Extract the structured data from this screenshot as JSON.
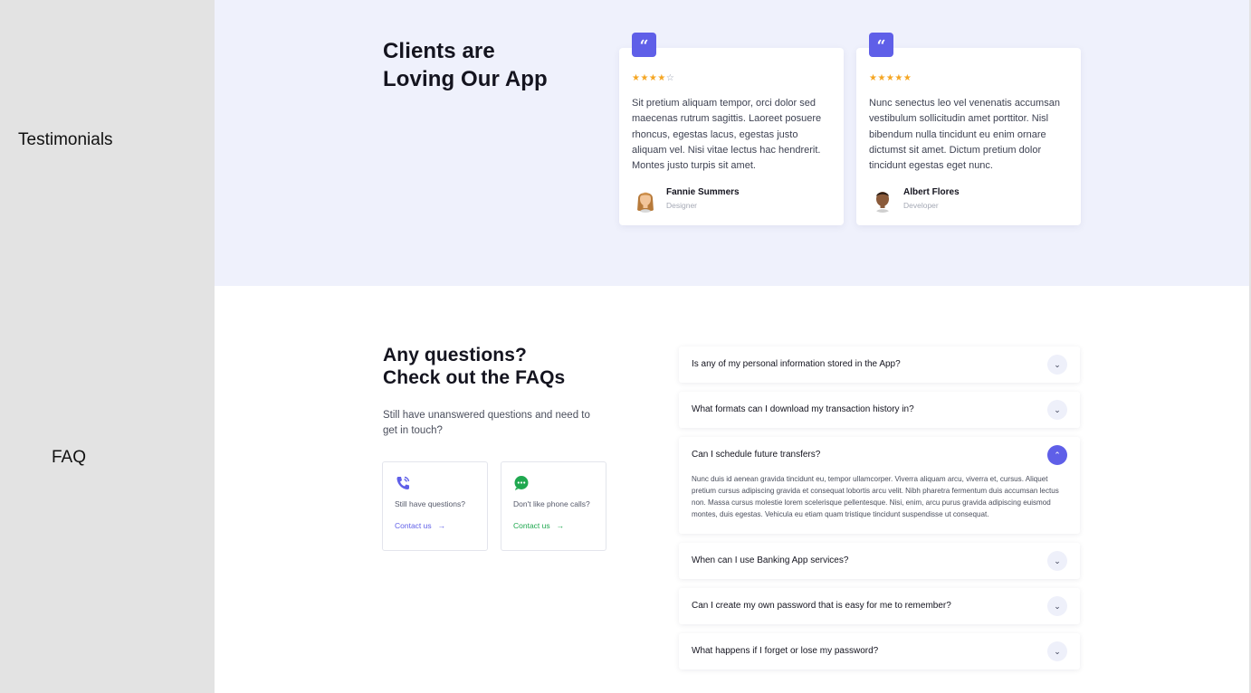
{
  "sidebar": {
    "testimonials_label": "Testimonials",
    "faq_label": "FAQ"
  },
  "testimonials": {
    "title_line1": "Clients are",
    "title_line2": "Loving Our App",
    "quote_glyph": "“",
    "cards": [
      {
        "stars_filled": "★★★★",
        "stars_empty": "☆",
        "rating": 4,
        "text": "Sit pretium aliquam tempor, orci dolor sed maecenas rutrum sagittis. Laoreet posuere rhoncus, egestas lacus, egestas justo aliquam vel. Nisi vitae lectus hac hendrerit. Montes justo turpis sit amet.",
        "name": "Fannie Summers",
        "role": "Designer",
        "avatar_icon": "female-avatar-icon"
      },
      {
        "stars_filled": "★★★★★",
        "stars_empty": "",
        "rating": 5,
        "text": "Nunc senectus leo vel venenatis accumsan vestibulum sollicitudin amet porttitor. Nisl bibendum nulla tincidunt eu enim ornare dictumst sit amet. Dictum pretium dolor tincidunt egestas eget nunc.",
        "name": "Albert Flores",
        "role": "Developer",
        "avatar_icon": "male-avatar-icon"
      }
    ]
  },
  "faq": {
    "title_line1": "Any questions?",
    "title_line2": "Check out the FAQs",
    "subtitle": "Still have unanswered questions and need to get in touch?",
    "contacts": [
      {
        "icon": "phone-icon",
        "question": "Still have  questions?",
        "link": "Contact us",
        "arrow": "→"
      },
      {
        "icon": "chat-icon",
        "question": "Don't like phone calls?",
        "link": "Contact us",
        "arrow": "→"
      }
    ],
    "items": [
      {
        "question": "Is any of my personal information stored in the App?",
        "open": false
      },
      {
        "question": "What formats can I download my transaction history in?",
        "open": false
      },
      {
        "question": "Can I schedule future transfers?",
        "open": true,
        "answer": "Nunc duis id aenean gravida tincidunt eu, tempor ullamcorper. Viverra aliquam arcu, viverra et, cursus. Aliquet pretium cursus adipiscing gravida et consequat lobortis arcu velit. Nibh pharetra fermentum duis accumsan lectus non. Massa cursus molestie lorem scelerisque pellentesque. Nisi, enim, arcu purus gravida adipiscing euismod montes, duis egestas. Vehicula eu etiam quam tristique tincidunt suspendisse ut consequat."
      },
      {
        "question": "When can I use Banking App services?",
        "open": false
      },
      {
        "question": "Can I create my own password that is easy for me to remember?",
        "open": false
      },
      {
        "question": "What happens if I forget or lose my password?",
        "open": false
      }
    ],
    "chevron_down": "⌄",
    "chevron_up": "⌃"
  },
  "colors": {
    "accent": "#5f5fe8",
    "green": "#1fa84f",
    "star": "#f5a623",
    "testimonials_bg": "#eff1fc",
    "sidebar_bg": "#e3e3e3"
  }
}
